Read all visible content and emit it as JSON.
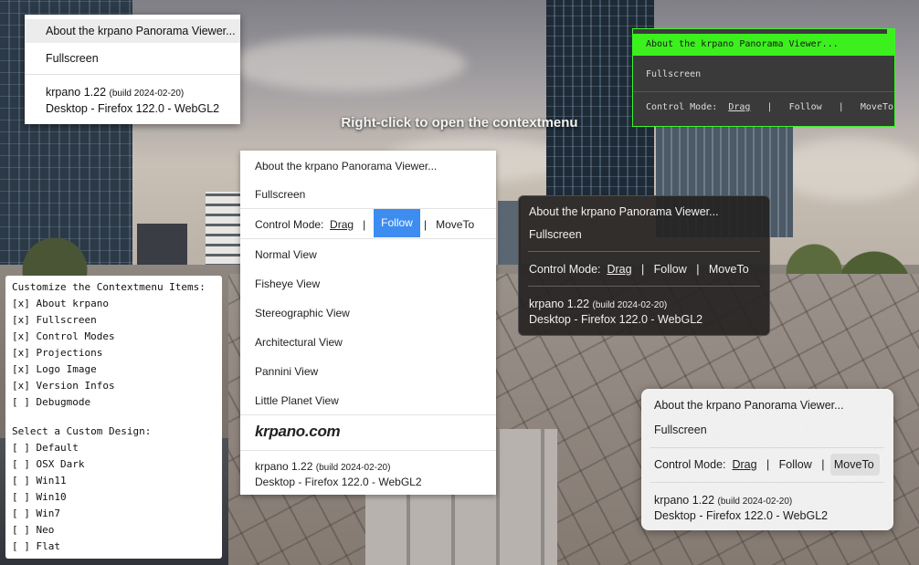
{
  "hint": "Right-click to open the contextmenu",
  "menu_win11": {
    "about": "About the krpano Panorama Viewer...",
    "fullscreen": "Fullscreen",
    "version": "krpano 1.22",
    "build": "(build 2024-02-20)",
    "platform": "Desktop - Firefox 122.0 - WebGL2"
  },
  "menu_flat": {
    "about": "About the krpano Panorama Viewer...",
    "fullscreen": "Fullscreen",
    "control_label": "Control Mode:",
    "drag": "Drag",
    "follow": "Follow",
    "moveto": "MoveTo",
    "divider": "|",
    "accent_color": "#3cf01e"
  },
  "menu_default": {
    "about": "About the krpano Panorama Viewer...",
    "fullscreen": "Fullscreen",
    "control_label": "Control Mode:",
    "drag": "Drag",
    "follow": "Follow",
    "moveto": "MoveTo",
    "divider": "|",
    "projections": [
      "Normal View",
      "Fisheye View",
      "Stereographic View",
      "Architectural View",
      "Pannini View",
      "Little Planet View"
    ],
    "logo": "krpano.com",
    "version": "krpano 1.22",
    "build": "(build 2024-02-20)",
    "platform": "Desktop - Firefox 122.0 - WebGL2",
    "selected_color": "#3d8cf0"
  },
  "menu_osx_dark": {
    "about": "About the krpano Panorama Viewer...",
    "fullscreen": "Fullscreen",
    "control_label": "Control Mode:",
    "drag": "Drag",
    "follow": "Follow",
    "moveto": "MoveTo",
    "divider": "|",
    "version": "krpano 1.22",
    "build": "(build 2024-02-20)",
    "platform": "Desktop - Firefox 122.0 - WebGL2"
  },
  "menu_win10": {
    "about": "About the krpano Panorama Viewer...",
    "fullscreen": "Fullscreen",
    "control_label": "Control Mode:",
    "drag": "Drag",
    "follow": "Follow",
    "moveto": "MoveTo",
    "divider": "|",
    "version": "krpano 1.22",
    "build": "(build 2024-02-20)",
    "platform": "Desktop - Firefox 122.0 - WebGL2"
  },
  "panel": {
    "heading_items": "Customize the Contextmenu Items:",
    "items": [
      {
        "check": "[x]",
        "label": "About krpano"
      },
      {
        "check": "[x]",
        "label": "Fullscreen"
      },
      {
        "check": "[x]",
        "label": "Control Modes"
      },
      {
        "check": "[x]",
        "label": "Projections"
      },
      {
        "check": "[x]",
        "label": "Logo Image"
      },
      {
        "check": "[x]",
        "label": "Version Infos"
      },
      {
        "check": "[ ]",
        "label": "Debugmode"
      }
    ],
    "heading_design": "Select a Custom Design:",
    "designs": [
      {
        "check": "[ ]",
        "label": "Default"
      },
      {
        "check": "[ ]",
        "label": "OSX Dark"
      },
      {
        "check": "[ ]",
        "label": "Win11"
      },
      {
        "check": "[ ]",
        "label": "Win10"
      },
      {
        "check": "[ ]",
        "label": "Win7"
      },
      {
        "check": "[ ]",
        "label": "Neo"
      },
      {
        "check": "[ ]",
        "label": "Flat"
      }
    ]
  }
}
